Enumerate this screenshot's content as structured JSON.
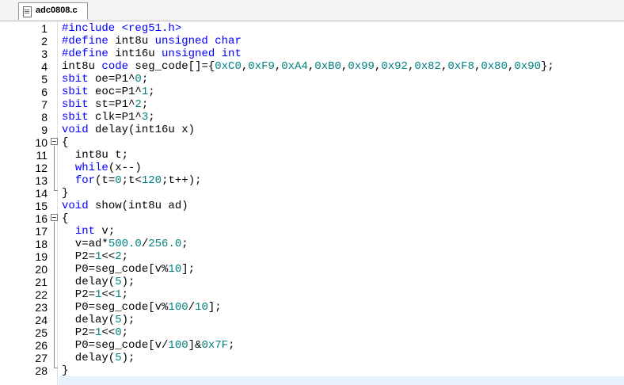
{
  "tab": {
    "filename": "adc0808.c"
  },
  "lines": [
    {
      "n": "1",
      "t": "#include <reg51.h>"
    },
    {
      "n": "2",
      "t": "#define int8u unsigned char"
    },
    {
      "n": "3",
      "t": "#define int16u unsigned int"
    },
    {
      "n": "4",
      "t": "int8u code seg_code[]={0xC0,0xF9,0xA4,0xB0,0x99,0x92,0x82,0xF8,0x80,0x90};"
    },
    {
      "n": "5",
      "t": "sbit oe=P1^0;"
    },
    {
      "n": "6",
      "t": "sbit eoc=P1^1;"
    },
    {
      "n": "7",
      "t": "sbit st=P1^2;"
    },
    {
      "n": "8",
      "t": "sbit clk=P1^3;"
    },
    {
      "n": "9",
      "t": "void delay(int16u x)"
    },
    {
      "n": "10",
      "t": "{"
    },
    {
      "n": "11",
      "t": "  int8u t;"
    },
    {
      "n": "12",
      "t": "  while(x--)"
    },
    {
      "n": "13",
      "t": "  for(t=0;t<120;t++);"
    },
    {
      "n": "14",
      "t": "}"
    },
    {
      "n": "15",
      "t": "void show(int8u ad)"
    },
    {
      "n": "16",
      "t": "{"
    },
    {
      "n": "17",
      "t": "  int v;"
    },
    {
      "n": "18",
      "t": "  v=ad*500.0/256.0;"
    },
    {
      "n": "19",
      "t": "  P2=1<<2;"
    },
    {
      "n": "20",
      "t": "  P0=seg_code[v%10];"
    },
    {
      "n": "21",
      "t": "  delay(5);"
    },
    {
      "n": "22",
      "t": "  P2=1<<1;"
    },
    {
      "n": "23",
      "t": "  P0=seg_code[v%100/10];"
    },
    {
      "n": "24",
      "t": "  delay(5);"
    },
    {
      "n": "25",
      "t": "  P2=1<<0;"
    },
    {
      "n": "26",
      "t": "  P0=seg_code[v/100]&0x7F;"
    },
    {
      "n": "27",
      "t": "  delay(5);"
    },
    {
      "n": "28",
      "t": "}"
    }
  ],
  "colors": {
    "keyword": "#0000ff",
    "number": "#008080",
    "current_line": "#e8f2fe"
  }
}
